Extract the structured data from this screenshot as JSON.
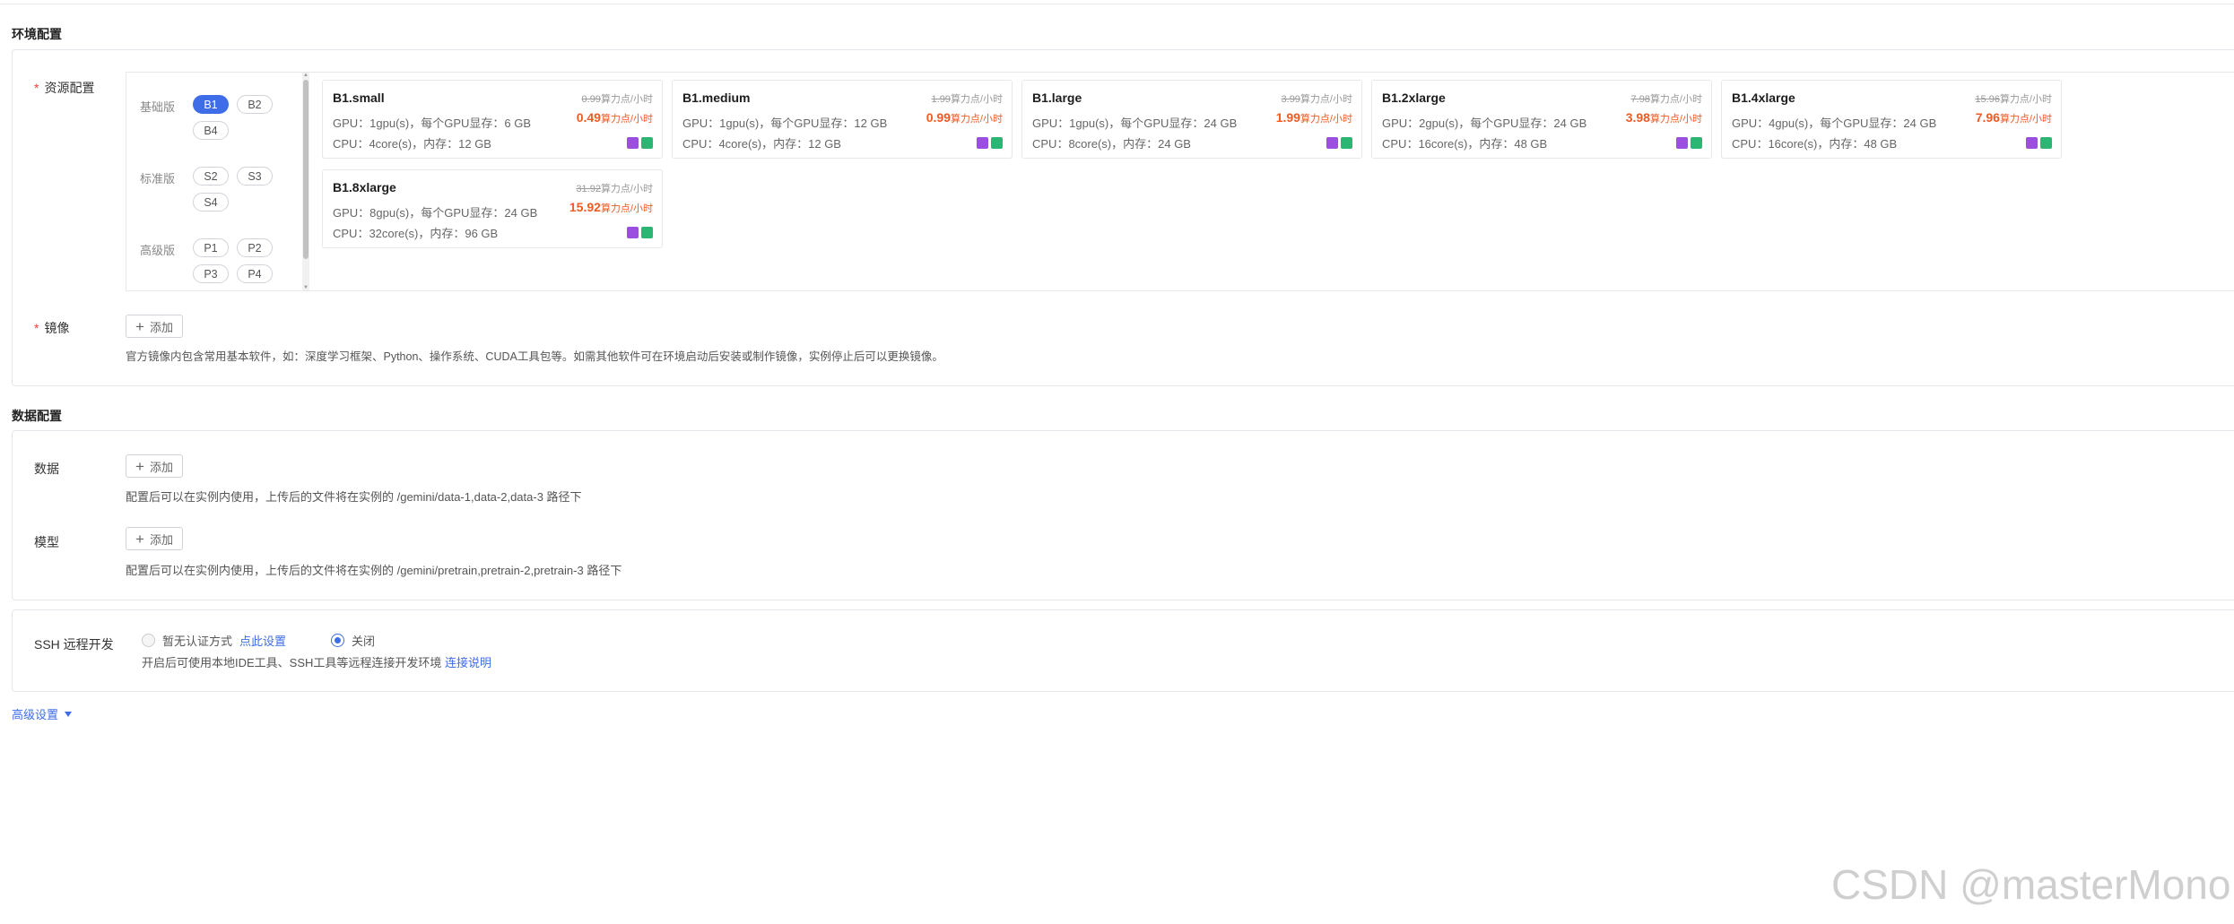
{
  "env_section": {
    "title": "环境配置",
    "resource_label": "资源配置",
    "image_label": "镜像",
    "image_hint": "官方镜像内包含常用基本软件，如：深度学习框架、Python、操作系统、CUDA工具包等。如需其他软件可在环境启动后安装或制作镜像，实例停止后可以更换镜像。"
  },
  "series": [
    {
      "label": "基础版",
      "chips": [
        "B1",
        "B2",
        "B4"
      ],
      "active": "B1"
    },
    {
      "label": "标准版",
      "chips": [
        "S2",
        "S3",
        "S4"
      ]
    },
    {
      "label": "高级版",
      "chips": [
        "P1",
        "P2",
        "P3",
        "P4"
      ]
    }
  ],
  "unit": "算力点/小时",
  "cards": [
    {
      "name": "B1.small",
      "old_price": "0.99",
      "price": "0.49",
      "gpu": "GPU：1gpu(s)，每个GPU显存：6 GB",
      "cpu": "CPU：4core(s)，内存：12 GB"
    },
    {
      "name": "B1.medium",
      "old_price": "1.99",
      "price": "0.99",
      "gpu": "GPU：1gpu(s)，每个GPU显存：12 GB",
      "cpu": "CPU：4core(s)，内存：12 GB"
    },
    {
      "name": "B1.large",
      "old_price": "3.99",
      "price": "1.99",
      "gpu": "GPU：1gpu(s)，每个GPU显存：24 GB",
      "cpu": "CPU：8core(s)，内存：24 GB"
    },
    {
      "name": "B1.2xlarge",
      "old_price": "7.98",
      "price": "3.98",
      "gpu": "GPU：2gpu(s)，每个GPU显存：24 GB",
      "cpu": "CPU：16core(s)，内存：48 GB"
    },
    {
      "name": "B1.4xlarge",
      "old_price": "15.96",
      "price": "7.96",
      "gpu": "GPU：4gpu(s)，每个GPU显存：24 GB",
      "cpu": "CPU：16core(s)，内存：48 GB"
    },
    {
      "name": "B1.8xlarge",
      "old_price": "31.92",
      "price": "15.92",
      "gpu": "GPU：8gpu(s)，每个GPU显存：24 GB",
      "cpu": "CPU：32core(s)，内存：96 GB"
    }
  ],
  "add_label": "添加",
  "data_section": {
    "title": "数据配置",
    "data_label": "数据",
    "data_hint": "配置后可以在实例内使用，上传后的文件将在实例的 /gemini/data-1,data-2,data-3 路径下",
    "model_label": "模型",
    "model_hint": "配置后可以在实例内使用，上传后的文件将在实例的 /gemini/pretrain,pretrain-2,pretrain-3 路径下"
  },
  "ssh": {
    "label": "SSH 远程开发",
    "option_none": "暂无认证方式",
    "option_none_link": "点此设置",
    "option_off": "关闭",
    "hint": "开启后可使用本地IDE工具、SSH工具等远程连接开发环境",
    "hint_link": "连接说明"
  },
  "advanced_label": "高级设置",
  "watermark": "CSDN @masterMono",
  "colors": {
    "accent": "#3f6de8",
    "price": "#f05a23",
    "required": "#f53f3f"
  }
}
